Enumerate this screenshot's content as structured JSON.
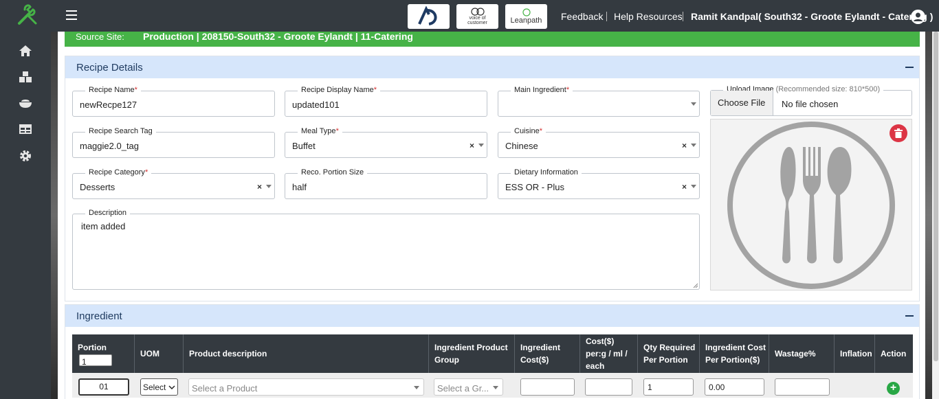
{
  "header": {
    "brands": [
      "AD",
      "voice of customer",
      "Leanpath"
    ],
    "links": {
      "feedback": "Feedback",
      "help": "Help Resources",
      "user": "Ramit Kandpal( South32 - Groote Eylandt - Catering )"
    }
  },
  "sidebar": {
    "icons": [
      "home-icon",
      "boxes-icon",
      "bowl-icon",
      "table-icon",
      "gear-icon"
    ]
  },
  "source": {
    "label": "Source Site:",
    "value": "Production | 208150-South32 - Groote Eylandt | 11-Catering"
  },
  "recipe": {
    "title": "Recipe Details",
    "fields": {
      "name": {
        "label": "Recipe Name",
        "required": "*",
        "value": "newRecpe127"
      },
      "display_name": {
        "label": "Recipe Display Name",
        "required": "*",
        "value": "updated101"
      },
      "main_ingredient": {
        "label": "Main Ingredient",
        "required": "*",
        "value": ""
      },
      "search_tag": {
        "label": "Recipe Search Tag",
        "value": "maggie2.0_tag"
      },
      "meal_type": {
        "label": "Meal Type",
        "required": "*",
        "value": "Buffet"
      },
      "cuisine": {
        "label": "Cuisine",
        "required": "*",
        "value": "Chinese"
      },
      "category": {
        "label": "Recipe Category",
        "required": "*",
        "value": "Desserts"
      },
      "portion_size": {
        "label": "Reco. Portion Size",
        "value": "half"
      },
      "dietary": {
        "label": "Dietary Information",
        "value": "ESS OR - Plus"
      },
      "description": {
        "label": "Description",
        "value": "item added"
      }
    },
    "upload": {
      "label": "Upload Image",
      "hint": "(Recommended size: 810*500)",
      "button": "Choose File",
      "status": "No file chosen"
    },
    "clear_symbol": "×"
  },
  "ingredient": {
    "title": "Ingredient",
    "columns": [
      {
        "l1": "Portion",
        "l2": ""
      },
      {
        "l1": "UOM",
        "l2": ""
      },
      {
        "l1": "Product description",
        "l2": ""
      },
      {
        "l1": "Ingredient Product",
        "l2": "Group"
      },
      {
        "l1": "Ingredient",
        "l2": "Cost($)"
      },
      {
        "l1": "Cost($)",
        "l2": "per:g / ml /",
        "l3": "each"
      },
      {
        "l1": "Qty Required",
        "l2": "Per Portion"
      },
      {
        "l1": "Ingredient Cost",
        "l2": "Per Portion($)"
      },
      {
        "l1": "Wastage%",
        "l2": ""
      },
      {
        "l1": "Inflation",
        "l2": ""
      },
      {
        "l1": "Action",
        "l2": ""
      }
    ],
    "portion_value": "1",
    "row": {
      "seq": "01",
      "uom": "Select",
      "product_placeholder": "Select a Product",
      "group_placeholder": "Select a Gr...",
      "ingredient_cost": "",
      "cost_per": "",
      "qty": "1",
      "cost_per_portion": "0.00",
      "wastage": "",
      "add": "+"
    }
  }
}
